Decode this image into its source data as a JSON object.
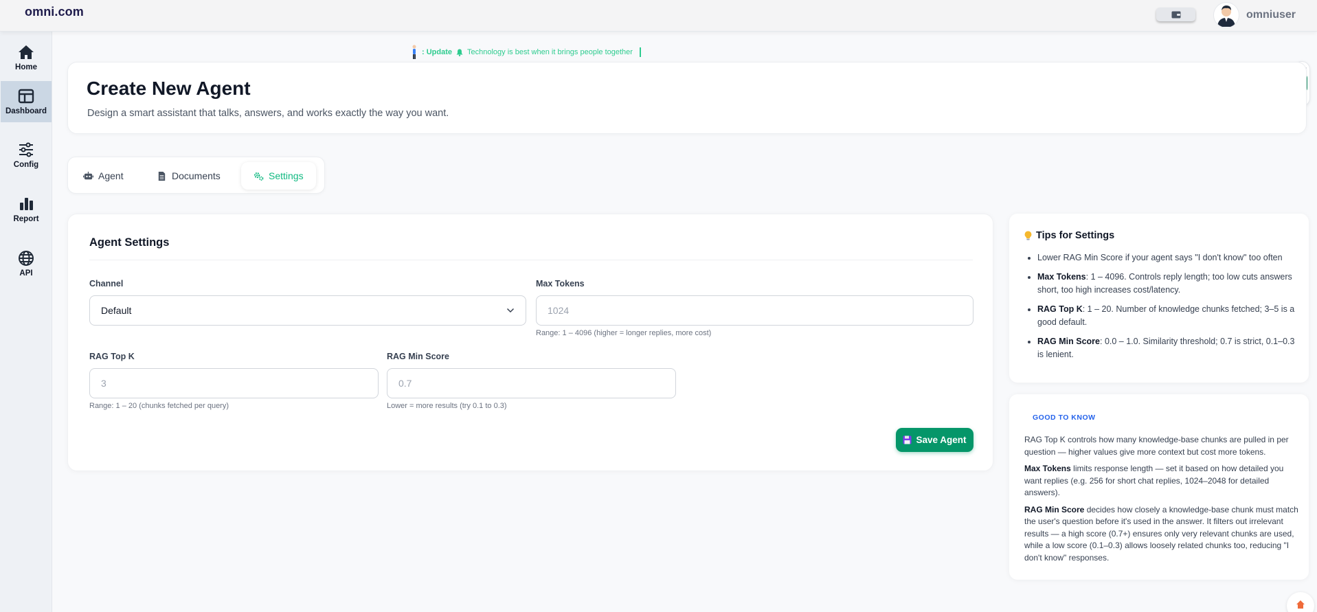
{
  "topbar": {
    "brand": "omni.com",
    "username": "omniuser"
  },
  "sidebar": {
    "items": [
      {
        "label": "Home",
        "icon": "home-icon",
        "active": false
      },
      {
        "label": "Dashboard",
        "icon": "dashboard-icon",
        "active": true
      },
      {
        "label": "Config",
        "icon": "sliders-icon",
        "active": false
      },
      {
        "label": "Report",
        "icon": "bar-chart-icon",
        "active": false
      },
      {
        "label": "API",
        "icon": "globe-icon",
        "active": false
      }
    ]
  },
  "marquee": {
    "prefix": ": Update",
    "message": "Technology is best when it brings people together"
  },
  "header": {
    "title": "Create New Agent",
    "subtitle": "Design a smart assistant that talks, answers, and works exactly the way you want."
  },
  "tabs": [
    {
      "label": "Agent",
      "icon": "robot-icon",
      "active": false
    },
    {
      "label": "Documents",
      "icon": "document-icon",
      "active": false
    },
    {
      "label": "Settings",
      "icon": "cogs-icon",
      "active": true
    }
  ],
  "settings": {
    "title": "Agent Settings",
    "channel": {
      "label": "Channel",
      "value": "Default"
    },
    "max_tokens": {
      "label": "Max Tokens",
      "placeholder": "1024",
      "hint": "Range: 1 – 4096 (higher = longer replies, more cost)"
    },
    "rag_top_k": {
      "label": "RAG Top K",
      "placeholder": "3",
      "hint": "Range: 1 – 20 (chunks fetched per query)"
    },
    "rag_min_score": {
      "label": "RAG Min Score",
      "placeholder": "0.7",
      "hint": "Lower = more results (try 0.1 to 0.3)"
    },
    "save_label": "Save Agent"
  },
  "tips": {
    "title": "Tips for Settings",
    "items": [
      {
        "bold": "",
        "text": "Lower RAG Min Score if your agent says \"I don't know\" too often"
      },
      {
        "bold": "Max Tokens",
        "text": ": 1 – 4096. Controls reply length; too low cuts answers short, too high increases cost/latency."
      },
      {
        "bold": "RAG Top K",
        "text": ": 1 – 20. Number of knowledge chunks fetched; 3–5 is a good default."
      },
      {
        "bold": "RAG Min Score",
        "text": ": 0.0 – 1.0. Similarity threshold; 0.7 is strict, 0.1–0.3 is lenient."
      }
    ]
  },
  "good_to_know": {
    "title": "GOOD TO KNOW",
    "p1": "RAG Top K controls how many knowledge-base chunks are pulled in per question — higher values give more context but cost more tokens.",
    "p2_bold": "Max Tokens",
    "p2": " limits response length — set it based on how detailed you want replies (e.g. 256 for short chat replies, 1024–2048 for detailed answers).",
    "p3_bold": "RAG Min Score",
    "p3": " decides how closely a knowledge-base chunk must match the user's question before it's used in the answer. It filters out irrelevant results — a high score (0.7+) ensures only very relevant chunks are used, while a low score (0.1–0.3) allows loosely related chunks too, reducing \"I don't know\" responses."
  },
  "colors": {
    "accent": "#10b981",
    "save_button": "#059669",
    "info_title": "#2563eb",
    "sidebar_active": "#cbd7e4"
  }
}
